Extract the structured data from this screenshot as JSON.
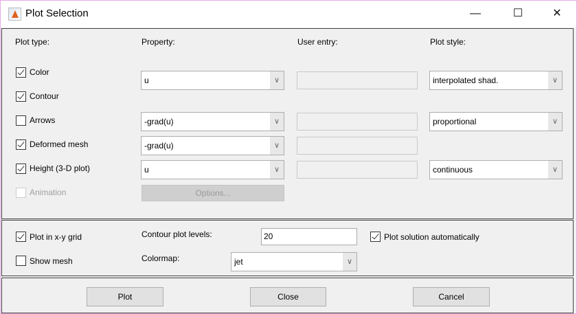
{
  "window": {
    "title": "Plot Selection",
    "icons": [
      "matlab-icon",
      "minimize-icon",
      "maximize-icon",
      "close-icon"
    ]
  },
  "headers": {
    "plot_type": "Plot type:",
    "property": "Property:",
    "user_entry": "User entry:",
    "plot_style": "Plot style:"
  },
  "plot_types": [
    {
      "label": "Color",
      "checked": true
    },
    {
      "label": "Contour",
      "checked": true
    },
    {
      "label": "Arrows",
      "checked": false
    },
    {
      "label": "Deformed mesh",
      "checked": true
    },
    {
      "label": "Height (3-D plot)",
      "checked": true
    },
    {
      "label": "Animation",
      "checked": false,
      "disabled": true
    }
  ],
  "properties": {
    "color_contour": "u",
    "arrows": "-grad(u)",
    "deformed": "-grad(u)",
    "height": "u"
  },
  "styles": {
    "color_contour": "interpolated shad.",
    "arrows": "proportional",
    "height": "continuous"
  },
  "options_label": "Options...",
  "options": {
    "plot_grid": {
      "label": "Plot in x-y grid",
      "checked": true
    },
    "show_mesh": {
      "label": "Show mesh",
      "checked": false
    },
    "contour_levels_label": "Contour plot levels:",
    "contour_levels": "20",
    "colormap_label": "Colormap:",
    "colormap": "jet",
    "auto": {
      "label": "Plot solution automatically",
      "checked": true
    }
  },
  "buttons": {
    "plot": "Plot",
    "close": "Close",
    "cancel": "Cancel"
  }
}
